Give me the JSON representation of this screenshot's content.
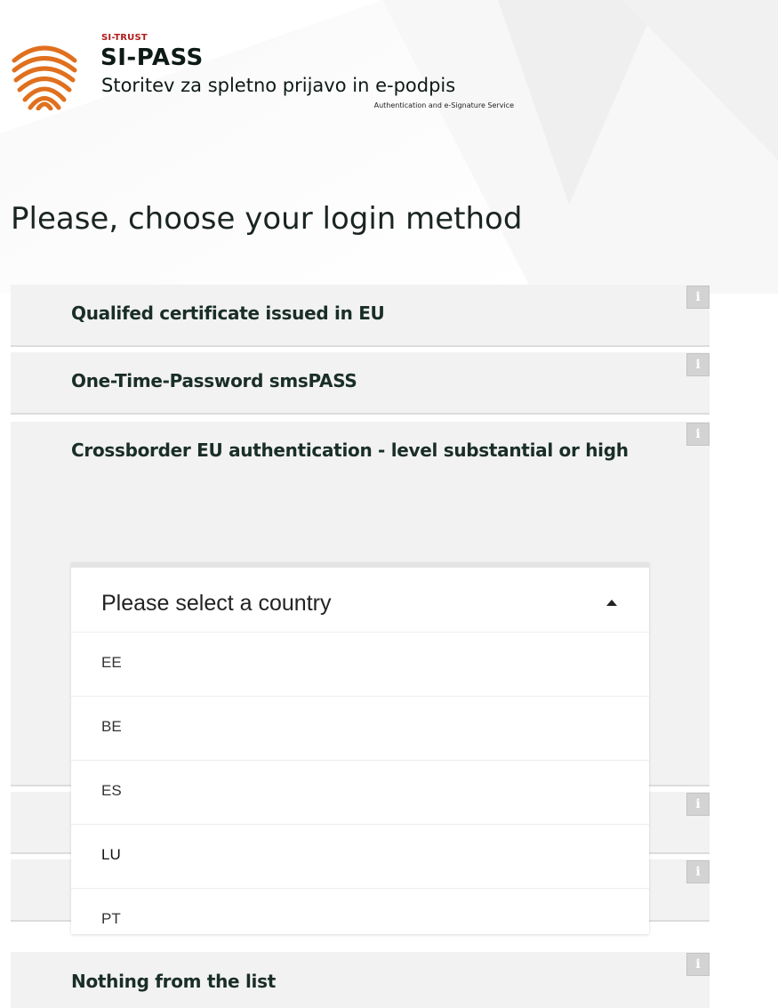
{
  "header": {
    "brand_small": "SI-TRUST",
    "brand_name": "SI-PASS",
    "subtitle": "Storitev za spletno prijavo in e-podpis",
    "subtitle_en": "Authentication and e-Signature Service",
    "logo_icon": "fingerprint-icon",
    "logo_color": "#e0701e"
  },
  "page_title": "Please, choose your login method",
  "methods": [
    {
      "label": "Qualifed certificate issued in EU",
      "info": "i"
    },
    {
      "label": "One-Time-Password smsPASS",
      "info": "i"
    },
    {
      "label": "Crossborder EU authentication - level substantial or high",
      "info": "i"
    },
    {
      "label": "",
      "info": "i"
    },
    {
      "label": "",
      "info": "i"
    },
    {
      "label": "Nothing from the list",
      "info": "i"
    }
  ],
  "country_select": {
    "placeholder": "Please select a country",
    "expanded": true,
    "options": [
      "EE",
      "BE",
      "ES",
      "LU",
      "PT"
    ]
  }
}
